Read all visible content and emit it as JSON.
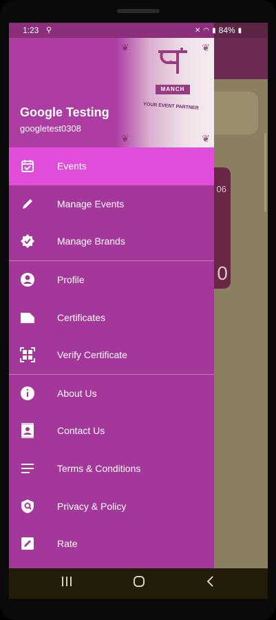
{
  "status_bar": {
    "time": "1:23",
    "battery": "84%"
  },
  "background": {
    "card_text_top": "06",
    "card_text_bottom": "0"
  },
  "header": {
    "user_name": "Google Testing",
    "user_id": "googletest0308",
    "logo_text": "MANCH",
    "logo_tagline": "YOUR EVENT PARTNER"
  },
  "menu": {
    "groups": [
      [
        {
          "label": "Events",
          "icon": "calendar-check-icon"
        },
        {
          "label": "Manage Events",
          "icon": "pencil-icon"
        },
        {
          "label": "Manage Brands",
          "icon": "verified-badge-icon"
        }
      ],
      [
        {
          "label": "Profile",
          "icon": "account-circle-icon"
        },
        {
          "label": "Certificates",
          "icon": "file-icon"
        },
        {
          "label": "Verify Certificate",
          "icon": "qr-code-icon"
        }
      ],
      [
        {
          "label": "About Us",
          "icon": "info-icon"
        },
        {
          "label": "Contact Us",
          "icon": "contact-card-icon"
        },
        {
          "label": "Terms & Conditions",
          "icon": "text-lines-icon"
        },
        {
          "label": "Privacy & Policy",
          "icon": "privacy-shield-icon"
        },
        {
          "label": "Rate",
          "icon": "rate-icon"
        }
      ]
    ]
  },
  "colors": {
    "drawer": "#a3379a",
    "active_item": "#e04dda",
    "app_bar": "#6b2a52"
  }
}
